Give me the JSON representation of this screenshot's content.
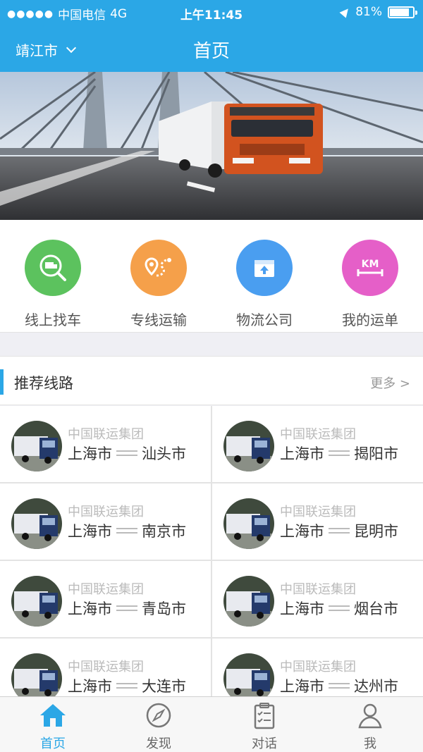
{
  "status_bar": {
    "carrier": "中国电信",
    "network": "4G",
    "time": "上午11:45",
    "battery": "81%"
  },
  "header": {
    "city": "靖江市",
    "title": "首页"
  },
  "quick_actions": [
    {
      "label": "线上找车",
      "icon": "truck-search-icon",
      "color": "#5cc25e"
    },
    {
      "label": "专线运输",
      "icon": "route-pin-icon",
      "color": "#f5a04a"
    },
    {
      "label": "物流公司",
      "icon": "box-upload-icon",
      "color": "#4a9ef0"
    },
    {
      "label": "我的运单",
      "icon": "km-distance-icon",
      "color": "#e55fc8"
    }
  ],
  "section": {
    "title": "推荐线路",
    "more": "更多 >"
  },
  "routes": [
    {
      "company": "中国联运集团",
      "from": "上海市",
      "to": "汕头市"
    },
    {
      "company": "中国联运集团",
      "from": "上海市",
      "to": "揭阳市"
    },
    {
      "company": "中国联运集团",
      "from": "上海市",
      "to": "南京市"
    },
    {
      "company": "中国联运集团",
      "from": "上海市",
      "to": "昆明市"
    },
    {
      "company": "中国联运集团",
      "from": "上海市",
      "to": "青岛市"
    },
    {
      "company": "中国联运集团",
      "from": "上海市",
      "to": "烟台市"
    },
    {
      "company": "中国联运集团",
      "from": "上海市",
      "to": "大连市"
    },
    {
      "company": "中国联运集团",
      "from": "上海市",
      "to": "达州市"
    }
  ],
  "tabs": [
    {
      "label": "首页",
      "icon": "home-icon",
      "active": true
    },
    {
      "label": "发现",
      "icon": "compass-icon",
      "active": false
    },
    {
      "label": "对话",
      "icon": "clipboard-icon",
      "active": false
    },
    {
      "label": "我",
      "icon": "user-icon",
      "active": false
    }
  ],
  "colors": {
    "primary": "#2ba7e6",
    "active_tab": "#2ba7e6"
  }
}
